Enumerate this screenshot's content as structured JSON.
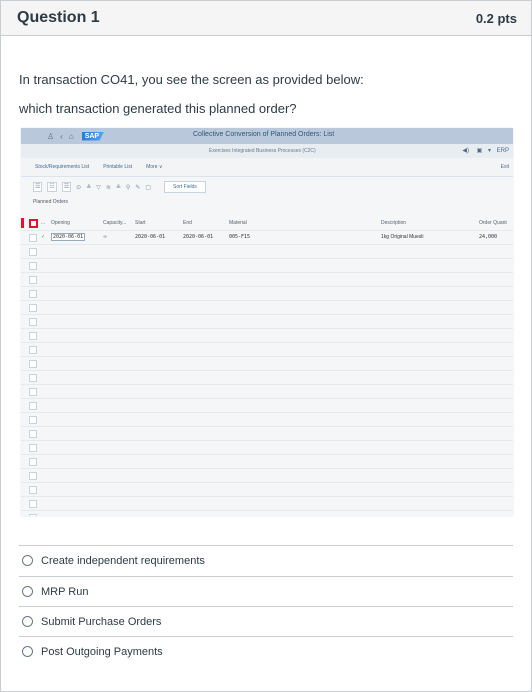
{
  "question": {
    "title": "Question 1",
    "points": "0.2 pts",
    "text_line1": "In transaction CO41, you see the screen as provided below:",
    "text_line2": "which transaction generated this planned order?"
  },
  "sap_screen": {
    "window_title": "Collective Conversion of Planned Orders: List",
    "logo": "SAP",
    "subtitle": "Exercises Integrated Business Processes (C2C)",
    "system_label": "ERP",
    "menu": [
      "Stock/Requirements List",
      "Printable List",
      "More"
    ],
    "exit_label": "Exit",
    "sort_button": "Sort Fields",
    "section_title": "Planned Orders",
    "columns": {
      "ellipsis": "...",
      "opening": "Opening",
      "capacity": "Capacity...",
      "start": "Start",
      "end": "End",
      "material": "Material",
      "description": "Description",
      "order_qty": "Order Quant"
    },
    "row": {
      "opening": "2020-06-01",
      "start": "2020-06-01",
      "end": "2020-06-01",
      "material": "005-F15",
      "description": "1kg Original Muesli",
      "order_qty": "24,000"
    }
  },
  "answers": [
    {
      "label": "Create independent requirements"
    },
    {
      "label": "MRP Run"
    },
    {
      "label": "Submit Purchase Orders"
    },
    {
      "label": "Post Outgoing Payments"
    }
  ]
}
